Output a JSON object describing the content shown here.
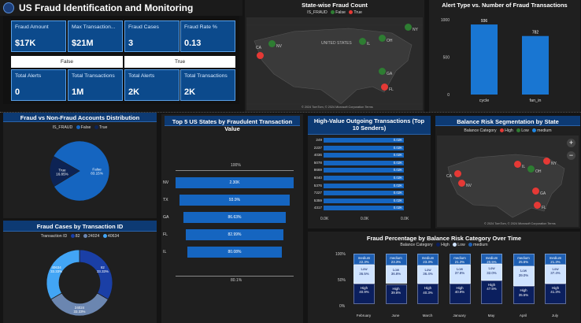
{
  "header": {
    "title": "US Fraud Identification and Monitoring"
  },
  "kpis": {
    "row1": [
      {
        "label": "Fraud Amount",
        "value": "$17K"
      },
      {
        "label": "Max Transaction...",
        "value": "$21M"
      },
      {
        "label": "Fraud Cases",
        "value": "3"
      },
      {
        "label": "Fraud Rate %",
        "value": "0.13"
      }
    ],
    "false_label": "False",
    "true_label": "True",
    "row2": [
      {
        "label": "Total Alerts",
        "value": "0"
      },
      {
        "label": "Total Transactions",
        "value": "1M"
      },
      {
        "label": "Total Alerts",
        "value": "2K"
      },
      {
        "label": "Total Transactions",
        "value": "2K"
      }
    ]
  },
  "statewise": {
    "title": "State-wise Fraud Count",
    "legend_title": "IS_FRAUD",
    "legend": [
      "False",
      "True"
    ],
    "labels": [
      "NV",
      "IL",
      "OH",
      "NY",
      "CA",
      "GA",
      "FL"
    ],
    "map_text": "UNITED STATES",
    "credit": "© 2024 TomTom, © 2024 Microsoft Corporation  Terms"
  },
  "alert_type": {
    "title": "Alert Type vs. Number of Fraud Transactions",
    "chart_data": {
      "type": "bar",
      "categories": [
        "cycle",
        "fan_in"
      ],
      "values": [
        936,
        782
      ],
      "data_labels": [
        "936",
        "782"
      ],
      "ylim": [
        0,
        1000
      ],
      "yticks": [
        "1000",
        "500",
        "0"
      ],
      "colors": [
        "#1976d2"
      ]
    }
  },
  "pie": {
    "title": "Fraud vs Non-Fraud Accounts Distribution",
    "legend_title": "IS_FRAUD",
    "legend": [
      "False",
      "True"
    ],
    "chart_data": {
      "type": "pie",
      "slices": [
        {
          "name": "False",
          "value": 83.15,
          "label": "83.15%",
          "color": "#1565c0"
        },
        {
          "name": "True",
          "value": 16.85,
          "label": "16.85%",
          "color": "#0d2354"
        }
      ]
    }
  },
  "funnel": {
    "title": "Top 5 US States by Fraudulent Transaction Value",
    "top_pct": "100%",
    "bottom_pct": "80.1%",
    "chart_data": {
      "type": "bar",
      "categories": [
        "NV",
        "TX",
        "GA",
        "FL",
        "IL"
      ],
      "values": [
        100,
        93.9,
        86.63,
        82.99,
        80.08
      ],
      "data_labels": [
        "2.30K",
        "93.9%",
        "86.63%",
        "82.99%",
        "80.08%"
      ]
    }
  },
  "senders": {
    "title": "High-Value Outgoing Transactions (Top 10 Senders)",
    "chart_data": {
      "type": "bar",
      "categories": [
        "249",
        "2237",
        "4036",
        "5078",
        "8669",
        "6040",
        "5376",
        "7227",
        "5359",
        "4317"
      ],
      "values": [
        0.02,
        0.02,
        0.02,
        0.02,
        0.02,
        0.02,
        0.02,
        0.02,
        0.02,
        0.02
      ],
      "data_labels": [
        "0.02K",
        "0.02K",
        "0.02K",
        "0.02K",
        "0.02K",
        "0.02K",
        "0.02K",
        "0.02K",
        "0.02K",
        "0.02K"
      ],
      "xticks": [
        "0.0K",
        "0.0K",
        "0.0K"
      ]
    }
  },
  "balance_seg": {
    "title": "Balance Risk Segmentation by State",
    "legend_title": "Balance Category",
    "legend": [
      "High",
      "Low",
      "medium"
    ],
    "labels": [
      "IL",
      "NY",
      "OH",
      "CA",
      "NV",
      "GA",
      "FL"
    ],
    "credit": "© 2024 TomTom, © 2024 Microsoft Corporation  Terms"
  },
  "txid": {
    "title": "Fraud Cases by Transaction ID",
    "legend_title": "Transaction ID",
    "legend": [
      "82",
      "24024",
      "40634"
    ],
    "chart_data": {
      "type": "pie",
      "donut": true,
      "slices": [
        {
          "name": "82",
          "value": 33.33,
          "label": "82\n33.33%",
          "color": "#1a3fa6"
        },
        {
          "name": "24024",
          "value": 33.33,
          "label": "24024\n33.33%",
          "color": "#6b86b0"
        },
        {
          "name": "40634",
          "value": 33.33,
          "label": "40634\n33.33%",
          "color": "#42a5f5"
        }
      ]
    }
  },
  "balance_time": {
    "title": "Fraud Percentage by Balance Risk Category Over Time",
    "legend_title": "Balance Category",
    "legend": [
      "High",
      "Low",
      "medium"
    ],
    "yticks": [
      "100%",
      "50%",
      "0%"
    ],
    "chart_data": {
      "type": "bar",
      "stacked": true,
      "categories": [
        "February",
        "June",
        "March",
        "January",
        "May",
        "April",
        "July"
      ],
      "series": [
        {
          "name": "High",
          "values": [
            40.0,
            39.8,
            40.3,
            40.9,
            47.5,
            35.5,
            41.3
          ],
          "labels": [
            "40.9%",
            "39.8%",
            "40.3%",
            "40.9%",
            "47.5%",
            "35.5%",
            "41.3%"
          ],
          "color": "#0b1f5e"
        },
        {
          "name": "Low",
          "values": [
            36.5,
            36.8,
            36.4,
            37.8,
            32.0,
            39.0,
            37.4
          ],
          "labels": [
            "36.5%",
            "36.8%",
            "36.4%",
            "37.8%",
            "32.0%",
            "39.0%",
            "37.4%"
          ],
          "color": "#cfe3ff"
        },
        {
          "name": "medium",
          "values": [
            22.3,
            23.3,
            23.3,
            21.3,
            20.5,
            25.5,
            21.3
          ],
          "labels": [
            "22.3%",
            "23.3%",
            "23.3%",
            "21.3%",
            "20.5%",
            "25.5%",
            "21.3%"
          ],
          "color": "#1e5fb3"
        }
      ]
    }
  }
}
